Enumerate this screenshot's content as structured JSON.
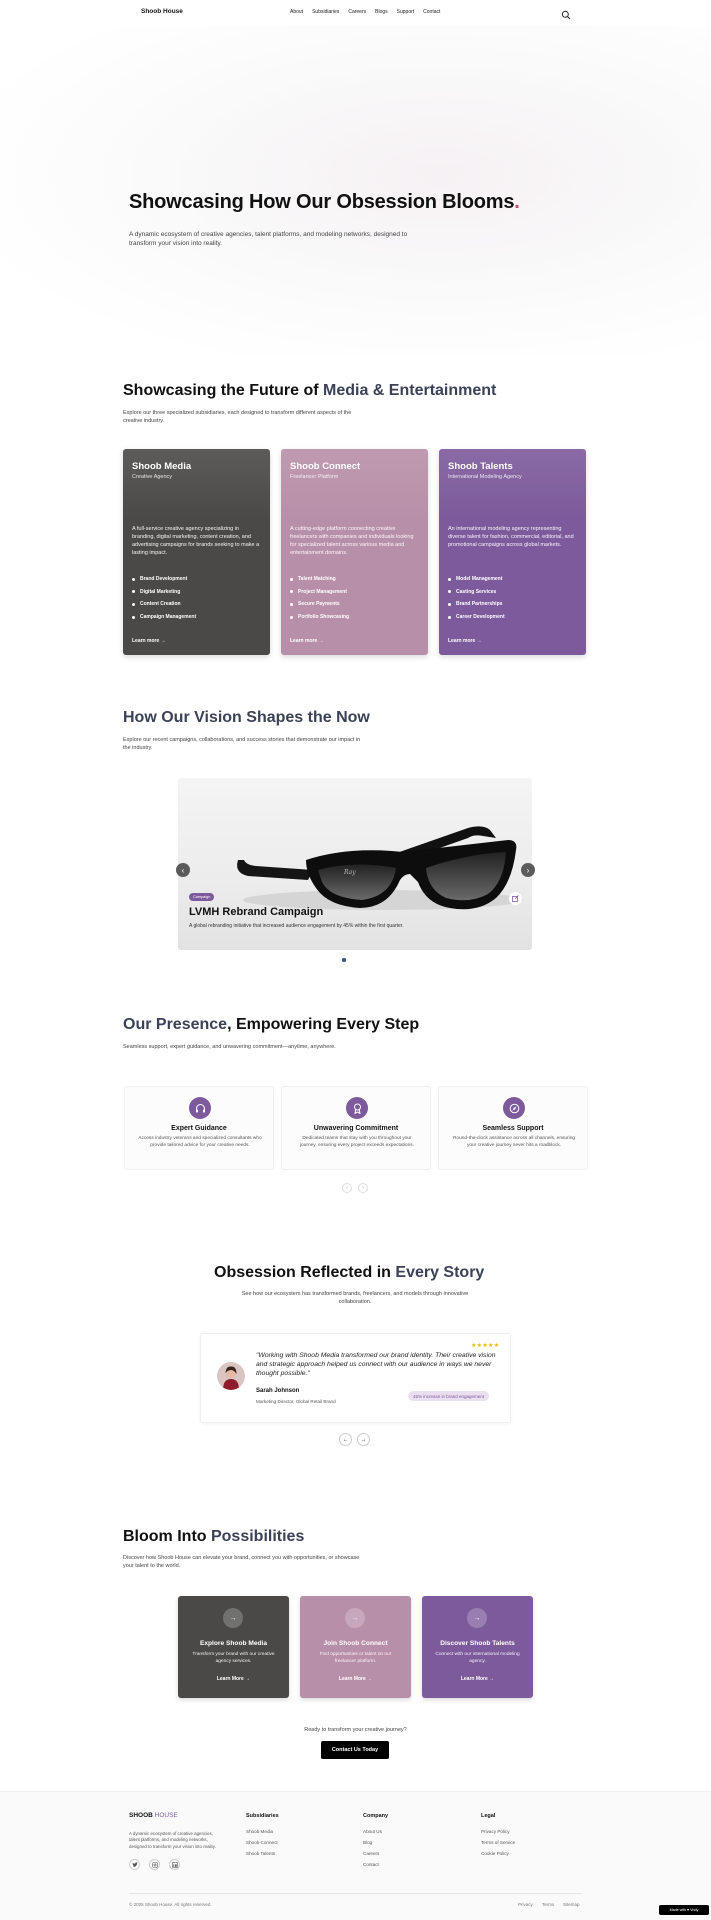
{
  "header": {
    "logo": "Shoob House",
    "nav": [
      "About",
      "Subsidiaries",
      "Careers",
      "Blogs",
      "Support",
      "Contact"
    ]
  },
  "hero": {
    "title": "Showcasing How Our Obsession Blooms",
    "title_dot": ".",
    "subtitle": "A dynamic ecosystem of creative agencies, talent platforms, and modeling networks, designed to transform your vision into reality."
  },
  "future": {
    "title_a": "Showcasing the Future of ",
    "title_b": "Media & Entertainment",
    "subtitle": "Explore our three specialized subsidiaries, each designed to transform different aspects of the creative industry.",
    "cards": [
      {
        "name": "Shoob Media",
        "kind": "Creative Agency",
        "desc": "A full-service creative agency specializing in branding, digital marketing, content creation, and advertising campaigns for brands seeking to make a lasting impact.",
        "features": [
          "Brand Development",
          "Digital Marketing",
          "Content Creation",
          "Campaign Management"
        ],
        "link": "Learn more →",
        "color": "#4a4948"
      },
      {
        "name": "Shoob Connect",
        "kind": "Freelancer Platform",
        "desc": "A cutting-edge platform connecting creative freelancers with companies and individuals looking for specialized talent across various media and entertainment domains.",
        "features": [
          "Talent Matching",
          "Project Management",
          "Secure Payments",
          "Portfolio Showcasing"
        ],
        "link": "Learn more →",
        "color": "#b88fa8"
      },
      {
        "name": "Shoob Talents",
        "kind": "International Modeling Agency",
        "desc": "An international modeling agency representing diverse talent for fashion, commercial, editorial, and promotional campaigns across global markets.",
        "features": [
          "Model Management",
          "Casting Services",
          "Brand Partnerships",
          "Career Development"
        ],
        "link": "Learn more →",
        "color": "#7d5a9b"
      }
    ]
  },
  "vision": {
    "title": "How Our Vision Shapes the Now",
    "subtitle": "Explore our recent campaigns, collaborations, and success stories that demonstrate our impact in the industry.",
    "slide": {
      "badge": "Campaign",
      "title": "LVMH Rebrand Campaign",
      "desc": "A global rebranding initiative that increased audience engagement by 45% within the first quarter."
    }
  },
  "presence": {
    "title_a": "Our Presence",
    "title_b": ", Empowering Every Step",
    "subtitle": "Seamless support, expert guidance, and unwavering commitment—anytime, anywhere.",
    "cards": [
      {
        "title": "Expert Guidance",
        "desc": "Access industry veterans and specialized consultants who provide tailored advice for your creative needs.",
        "icon": "headphones-icon"
      },
      {
        "title": "Unwavering Commitment",
        "desc": "Dedicated teams that stay with you throughout your journey, ensuring every project exceeds expectations.",
        "icon": "award-icon"
      },
      {
        "title": "Seamless Support",
        "desc": "Round-the-clock assistance across all channels, ensuring your creative journey never hits a roadblock.",
        "icon": "compass-icon"
      }
    ]
  },
  "story": {
    "title_a": "Obsession Reflected in ",
    "title_b": "Every Story",
    "subtitle": "See how our ecosystem has transformed brands, freelancers, and models through innovative collaboration.",
    "testimonial": {
      "stars": "★★★★★",
      "quote": "\"Working with Shoob Media transformed our brand identity. Their creative vision and strategic approach helped us connect with our audience in ways we never thought possible.\"",
      "name": "Sarah Johnson",
      "role": "Marketing Director, Global Retail Brand",
      "badge": "45% increase in brand engagement"
    }
  },
  "bloom": {
    "title_a": "Bloom Into ",
    "title_b": "Possibilities",
    "subtitle": "Discover how Shoob House can elevate your brand, connect you with opportunities, or showcase your talent to the world.",
    "cards": [
      {
        "title": "Explore Shoob Media",
        "desc": "Transform your brand with our creative agency services.",
        "link": "Learn More →",
        "color": "#4a4948"
      },
      {
        "title": "Join Shoob Connect",
        "desc": "Find opportunities or talent on our freelancer platform.",
        "link": "Learn More →",
        "color": "#b88fa8"
      },
      {
        "title": "Discover Shoob Talents",
        "desc": "Connect with our international modeling agency.",
        "link": "Learn More →",
        "color": "#7d5a9b"
      }
    ],
    "ready": "Ready to transform your creative journey?",
    "cta": "Contact Us Today"
  },
  "footer": {
    "logo_a": "SHOOB ",
    "logo_b": "HOUSE",
    "desc": "A dynamic ecosystem of creative agencies, talent platforms, and modeling networks, designed to transform your vision into reality.",
    "subsidiaries_title": "Subsidiaries",
    "subsidiaries": [
      "Shoob Media",
      "Shoob Connect",
      "Shoob Talents"
    ],
    "company_title": "Company",
    "company": [
      "About Us",
      "Blog",
      "Careers",
      "Contact"
    ],
    "legal_title": "Legal",
    "legal": [
      "Privacy Policy",
      "Terms of Service",
      "Cookie Policy"
    ],
    "copyright": "© 2025 Shoob House. All rights reserved.",
    "bottom_links": [
      "Privacy",
      "Terms",
      "Sitemap"
    ],
    "made_with": "Made with ♥ Visily"
  }
}
